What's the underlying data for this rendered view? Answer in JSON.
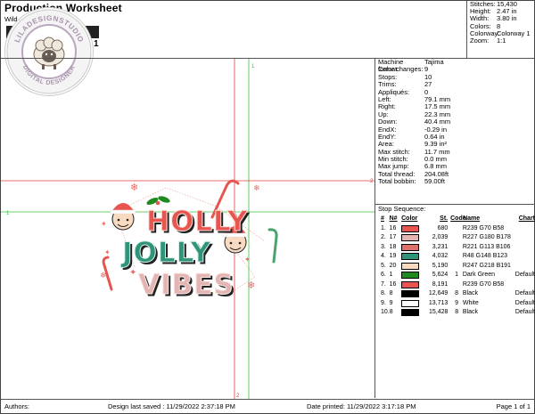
{
  "header": {
    "title": "Production Worksheet",
    "subtitle": "Wild...   ...esigning",
    "number": "1",
    "logo": {
      "top_text": "LILADESIGNSTUDIO",
      "bottom_text": "DIGITAL DESIGNER"
    }
  },
  "summary": [
    {
      "k": "Stitches:",
      "v": "15,430"
    },
    {
      "k": "Height:",
      "v": "2.47 in"
    },
    {
      "k": "Width:",
      "v": "3.80 in"
    },
    {
      "k": "Colors:",
      "v": "8"
    },
    {
      "k": "Colorway:",
      "v": "Colorway 1"
    },
    {
      "k": "Zoom:",
      "v": "1:1"
    }
  ],
  "info": [
    {
      "k": "Machine format:",
      "v": "Tajima"
    },
    {
      "k": "Color changes:",
      "v": "9"
    },
    {
      "k": "Stops:",
      "v": "10"
    },
    {
      "k": "Trims:",
      "v": "27"
    },
    {
      "k": "Appliqués:",
      "v": "0"
    },
    {
      "k": "Left:",
      "v": "79.1 mm"
    },
    {
      "k": "Right:",
      "v": "17.5 mm"
    },
    {
      "k": "Up:",
      "v": "22.3 mm"
    },
    {
      "k": "Down:",
      "v": "40.4 mm"
    },
    {
      "k": "EndX:",
      "v": "-0.29 in"
    },
    {
      "k": "EndY:",
      "v": "0.64 in"
    },
    {
      "k": "Area:",
      "v": "9.39 in²"
    },
    {
      "k": "Max stitch:",
      "v": "11.7 mm"
    },
    {
      "k": "Min stitch:",
      "v": "0.0 mm"
    },
    {
      "k": "Max jump:",
      "v": "6.8 mm"
    },
    {
      "k": "Total thread:",
      "v": "204.08ft"
    },
    {
      "k": "Total bobbin:",
      "v": "59.00ft"
    }
  ],
  "stop_sequence": {
    "title": "Stop Sequence:",
    "headers": {
      "num": "#",
      "n": "N#",
      "color": "Color",
      "st": "St.",
      "code": "Code",
      "name": "Name",
      "chart": "Chart"
    },
    "rows": [
      {
        "num": "1.",
        "n": "16",
        "color": "#e8554e",
        "st": "680",
        "code": "",
        "name": "R239 G70 B58",
        "chart": ""
      },
      {
        "num": "2.",
        "n": "17",
        "color": "#e3b4b2",
        "st": "2,039",
        "code": "",
        "name": "R227 G180 B178",
        "chart": ""
      },
      {
        "num": "3.",
        "n": "18",
        "color": "#dd716a",
        "st": "3,231",
        "code": "",
        "name": "R221 G113 B106",
        "chart": ""
      },
      {
        "num": "4.",
        "n": "19",
        "color": "#30947b",
        "st": "4,032",
        "code": "",
        "name": "R48 G148 B123",
        "chart": ""
      },
      {
        "num": "5.",
        "n": "20",
        "color": "#f7dabf",
        "st": "5,190",
        "code": "",
        "name": "R247 G218 B191",
        "chart": ""
      },
      {
        "num": "6.",
        "n": "1",
        "color": "#1f8a1f",
        "st": "5,624",
        "code": "1",
        "name": "Dark Green",
        "chart": "Default"
      },
      {
        "num": "7.",
        "n": "16",
        "color": "#e8554e",
        "st": "8,191",
        "code": "",
        "name": "R239 G70 B58",
        "chart": ""
      },
      {
        "num": "8.",
        "n": "8",
        "color": "#000000",
        "st": "12,649",
        "code": "8",
        "name": "Black",
        "chart": "Default"
      },
      {
        "num": "9.",
        "n": "9",
        "color": "#ffffff",
        "st": "13,713",
        "code": "9",
        "name": "White",
        "chart": "Default"
      },
      {
        "num": "10.",
        "n": "8",
        "color": "#000000",
        "st": "15,428",
        "code": "8",
        "name": "Black",
        "chart": "Default"
      }
    ]
  },
  "design": {
    "line1": "HOLLY",
    "line2": "JOLLY",
    "line3": "VIBES"
  },
  "guides": {
    "marker1": "1",
    "marker2": "2"
  },
  "footer": {
    "authors": "Authors:",
    "saved": "Design last saved : 11/29/2022 2:37:18 PM",
    "printed": "Date printed: 11/29/2022 3:17:18 PM",
    "page": "Page 1 of 1"
  }
}
